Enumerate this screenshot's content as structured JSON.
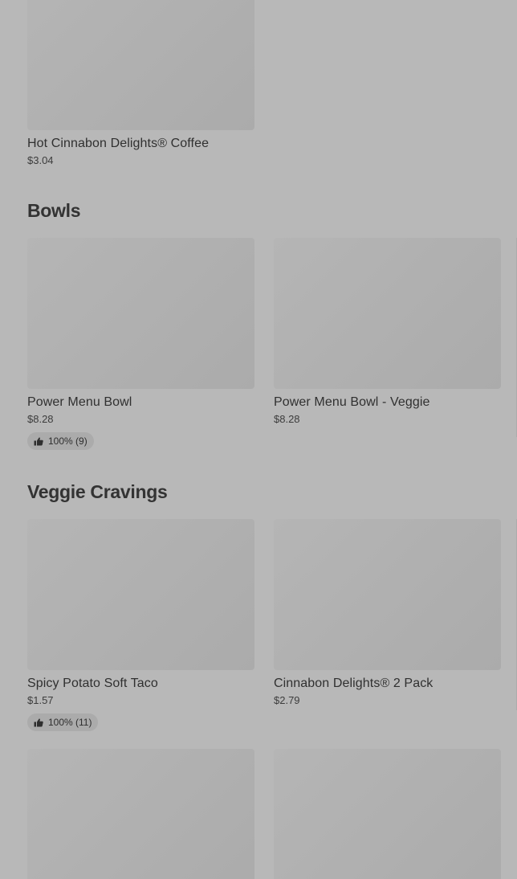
{
  "top_item": {
    "name": "Hot Cinnabon Delights® Coffee",
    "price": "$3.04"
  },
  "sections": [
    {
      "title": "Bowls",
      "items": [
        {
          "name": "Power Menu Bowl",
          "price": "$8.28",
          "rating": "100% (9)"
        },
        {
          "name": "Power Menu Bowl - Veggie",
          "price": "$8.28"
        }
      ]
    },
    {
      "title": "Veggie Cravings",
      "items": [
        {
          "name": "Spicy Potato Soft Taco",
          "price": "$1.57",
          "rating": "100% (11)"
        },
        {
          "name": "Cinnabon Delights® 2 Pack",
          "price": "$2.79"
        }
      ]
    }
  ],
  "icons": {
    "rating": "thumbs-up-icon"
  },
  "colors": {
    "overlay_background": "#b8b8b8",
    "image_placeholder": "#b0b0b0",
    "rating_pill": "#ababab"
  }
}
